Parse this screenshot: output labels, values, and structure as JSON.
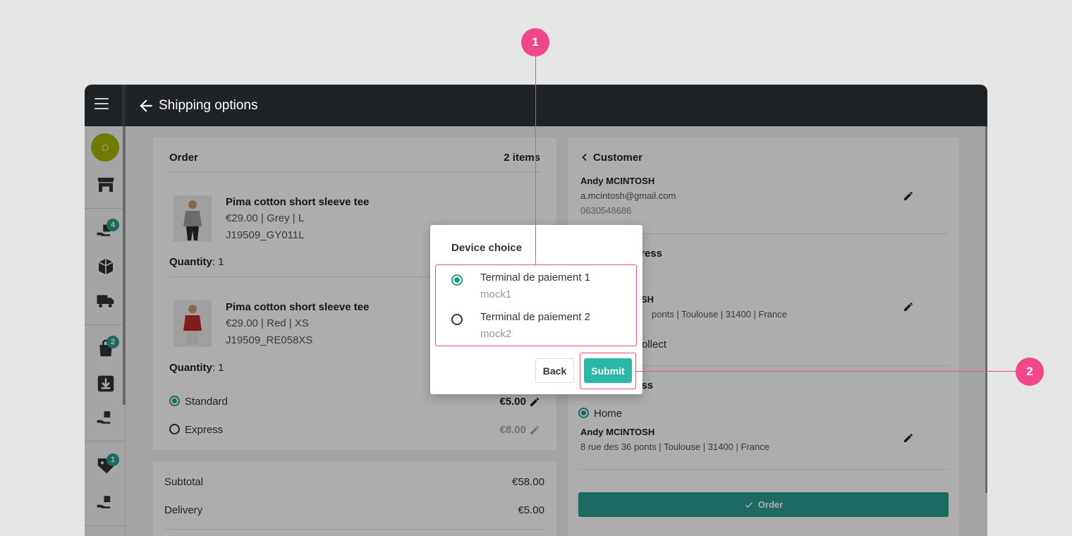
{
  "app": {
    "title": "Shipping options",
    "colors": {
      "accent": "#2a9d8f",
      "topbar": "#1f2326",
      "callout": "#f0468a"
    }
  },
  "sidebar": {
    "avatar_initial": "O",
    "badges": {
      "reservations": "4",
      "orders": "2",
      "promotions": "1"
    },
    "icons": [
      "store-icon",
      "hand-box-icon",
      "box-icon",
      "truck-icon",
      "bag-icon",
      "download-icon",
      "hand-bag-icon",
      "tag-icon",
      "hand-bag-icon"
    ]
  },
  "order": {
    "header": "Order",
    "count": "2 items",
    "items": [
      {
        "name": "Pima cotton short sleeve tee",
        "meta": "€29.00 | Grey | L",
        "sku": "J19509_GY011L",
        "quantity_label": "Quantity",
        "quantity": ": 1"
      },
      {
        "name": "Pima cotton short sleeve tee",
        "meta": "€29.00 | Red | XS",
        "sku": "J19509_RE058XS",
        "quantity_label": "Quantity",
        "quantity": ": 1"
      }
    ],
    "shipping": [
      {
        "label": "Standard",
        "price": "€5.00",
        "selected": true
      },
      {
        "label": "Express",
        "price": "€8.00",
        "selected": false
      }
    ]
  },
  "totals": {
    "subtotal_label": "Subtotal",
    "subtotal": "€58.00",
    "delivery_label": "Delivery",
    "delivery": "€5.00"
  },
  "customer": {
    "header": "Customer",
    "name": "Andy MCINTOSH",
    "email": "a.mcintosh@gmail.com",
    "phone": "0630548686",
    "section2_title_fragment": "ress",
    "section2_name_fragment": "SH",
    "section2_address_fragment": "ponts | Toulouse | 31400 | France",
    "section2_option_fragment": "ollect",
    "section3_title_fragment": "ss",
    "home_label": "Home",
    "home_name": "Andy MCINTOSH",
    "home_address": "8 rue des 36 ponts | Toulouse | 31400 | France",
    "order_button": "Order"
  },
  "dialog": {
    "title": "Device choice",
    "options": [
      {
        "label": "Terminal de paiement 1",
        "sub": "mock1",
        "selected": true
      },
      {
        "label": "Terminal de paiement 2",
        "sub": "mock2",
        "selected": false
      }
    ],
    "back_label": "Back",
    "submit_label": "Submit"
  },
  "callouts": {
    "one": "1",
    "two": "2"
  }
}
